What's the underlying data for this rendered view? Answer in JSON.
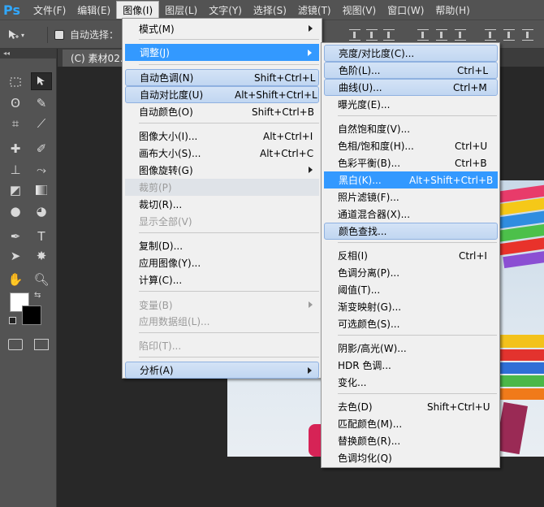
{
  "app": {
    "logo": "Ps"
  },
  "menubar": [
    {
      "label": "文件(F)"
    },
    {
      "label": "编辑(E)"
    },
    {
      "label": "图像(I)",
      "active": true
    },
    {
      "label": "图层(L)"
    },
    {
      "label": "文字(Y)"
    },
    {
      "label": "选择(S)"
    },
    {
      "label": "滤镜(T)"
    },
    {
      "label": "视图(V)"
    },
    {
      "label": "窗口(W)"
    },
    {
      "label": "帮助(H)"
    }
  ],
  "options": {
    "autoselect_label": "自动选择：",
    "move_tool_icon": "move-arrow-icon"
  },
  "toolpanel": {
    "header": "◂◂"
  },
  "document": {
    "tab_title": "(C) 素材02.jp"
  },
  "image_menu": {
    "items": [
      {
        "label": "模式(M)",
        "shortcut": "",
        "submenu": true
      },
      {
        "label": "调整(J)",
        "shortcut": "",
        "submenu": true,
        "state": "active"
      },
      {
        "label": "自动色调(N)",
        "shortcut": "Shift+Ctrl+L",
        "state": "hl"
      },
      {
        "label": "自动对比度(U)",
        "shortcut": "Alt+Shift+Ctrl+L",
        "state": "hl"
      },
      {
        "label": "自动颜色(O)",
        "shortcut": "Shift+Ctrl+B"
      },
      {
        "label": "图像大小(I)...",
        "shortcut": "Alt+Ctrl+I"
      },
      {
        "label": "画布大小(S)...",
        "shortcut": "Alt+Ctrl+C"
      },
      {
        "label": "图像旋转(G)",
        "shortcut": "",
        "submenu": true
      },
      {
        "label": "裁剪(P)",
        "shortcut": "",
        "disabled": true,
        "state": "dimhl"
      },
      {
        "label": "裁切(R)...",
        "shortcut": ""
      },
      {
        "label": "显示全部(V)",
        "shortcut": "",
        "disabled": true
      },
      {
        "label": "复制(D)...",
        "shortcut": ""
      },
      {
        "label": "应用图像(Y)...",
        "shortcut": ""
      },
      {
        "label": "计算(C)...",
        "shortcut": ""
      },
      {
        "label": "变量(B)",
        "shortcut": "",
        "disabled": true,
        "submenu": true
      },
      {
        "label": "应用数据组(L)...",
        "shortcut": "",
        "disabled": true
      },
      {
        "label": "陷印(T)...",
        "shortcut": "",
        "disabled": true
      },
      {
        "label": "分析(A)",
        "shortcut": "",
        "submenu": true,
        "state": "hl"
      }
    ]
  },
  "adjust_menu": {
    "items": [
      {
        "label": "亮度/对比度(C)...",
        "shortcut": "",
        "state": "hl"
      },
      {
        "label": "色阶(L)...",
        "shortcut": "Ctrl+L",
        "state": "hl"
      },
      {
        "label": "曲线(U)...",
        "shortcut": "Ctrl+M",
        "state": "hl"
      },
      {
        "label": "曝光度(E)...",
        "shortcut": ""
      },
      {
        "label": "自然饱和度(V)...",
        "shortcut": ""
      },
      {
        "label": "色相/饱和度(H)...",
        "shortcut": "Ctrl+U"
      },
      {
        "label": "色彩平衡(B)...",
        "shortcut": "Ctrl+B"
      },
      {
        "label": "黑白(K)...",
        "shortcut": "Alt+Shift+Ctrl+B",
        "state": "active"
      },
      {
        "label": "照片滤镜(F)...",
        "shortcut": ""
      },
      {
        "label": "通道混合器(X)...",
        "shortcut": ""
      },
      {
        "label": "颜色查找...",
        "shortcut": "",
        "state": "hl"
      },
      {
        "label": "反相(I)",
        "shortcut": "Ctrl+I"
      },
      {
        "label": "色调分离(P)...",
        "shortcut": ""
      },
      {
        "label": "阈值(T)...",
        "shortcut": ""
      },
      {
        "label": "渐变映射(G)...",
        "shortcut": ""
      },
      {
        "label": "可选颜色(S)...",
        "shortcut": ""
      },
      {
        "label": "阴影/高光(W)...",
        "shortcut": ""
      },
      {
        "label": "HDR 色调...",
        "shortcut": ""
      },
      {
        "label": "变化...",
        "shortcut": ""
      },
      {
        "label": "去色(D)",
        "shortcut": "Shift+Ctrl+U"
      },
      {
        "label": "匹配颜色(M)...",
        "shortcut": ""
      },
      {
        "label": "替换颜色(R)...",
        "shortcut": ""
      },
      {
        "label": "色调均化(Q)",
        "shortcut": ""
      }
    ]
  },
  "colors": {
    "accent": "#3399ff",
    "highlight": "#c8dbf4",
    "foreground": "#ffffff",
    "background": "#000000"
  }
}
